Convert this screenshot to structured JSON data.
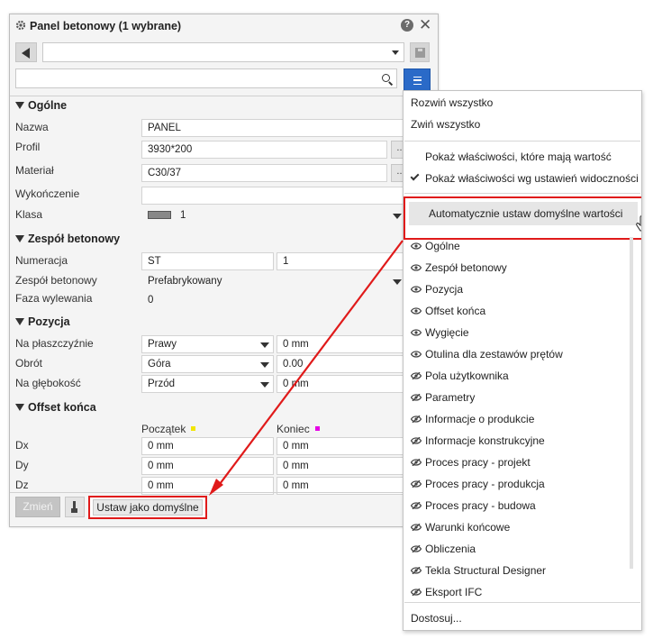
{
  "panel": {
    "title": "Panel betonowy (1 wybrane)",
    "help": "?",
    "preset_value": "",
    "search_placeholder": "",
    "sections": {
      "ogolne": "Ogólne",
      "zespol": "Zespół betonowy",
      "pozycja": "Pozycja",
      "offset": "Offset końca"
    },
    "ogolne": {
      "nazwa_label": "Nazwa",
      "nazwa_value": "PANEL",
      "profil_label": "Profil",
      "profil_value": "3930*200",
      "material_label": "Materiał",
      "material_value": "C30/37",
      "wykonczenie_label": "Wykończenie",
      "wykonczenie_value": "",
      "klasa_label": "Klasa",
      "klasa_value": "1"
    },
    "zespol": {
      "numeracja_label": "Numeracja",
      "numeracja_prefix": "ST",
      "numeracja_start": "1",
      "zespol_label": "Zespół betonowy",
      "zespol_value": "Prefabrykowany",
      "faza_label": "Faza wylewania",
      "faza_value": "0"
    },
    "pozycja": {
      "plaszczyzna_label": "Na płaszczyźnie",
      "plaszczyzna_value": "Prawy",
      "plaszczyzna_offset": "0 mm",
      "obrot_label": "Obrót",
      "obrot_value": "Góra",
      "obrot_offset": "0.00",
      "glebokosc_label": "Na głębokość",
      "glebokosc_value": "Przód",
      "glebokosc_offset": "0 mm"
    },
    "offset": {
      "start_header": "Początek",
      "end_header": "Koniec",
      "dx_label": "Dx",
      "dx_start": "0 mm",
      "dx_end": "0 mm",
      "dy_label": "Dy",
      "dy_start": "0 mm",
      "dy_end": "0 mm",
      "dz_label": "Dz",
      "dz_start": "0 mm",
      "dz_end": "0 mm"
    },
    "buttons": {
      "modify": "Zmień",
      "set_default": "Ustaw jako domyślne"
    }
  },
  "menu": {
    "expand_all": "Rozwiń wszystko",
    "collapse_all": "Zwiń wszystko",
    "show_with_value": "Pokaż właściwości, które mają wartość",
    "show_by_visibility": "Pokaż właściwości wg ustawień widoczności",
    "auto_defaults": "Automatycznie ustaw domyślne wartości",
    "customize": "Dostosuj...",
    "visible_groups": [
      "Ogólne",
      "Zespół betonowy",
      "Pozycja",
      "Offset końca",
      "Wygięcie",
      "Otulina dla zestawów prętów"
    ],
    "hidden_groups": [
      "Pola użytkownika",
      "Parametry",
      "Informacje o produkcie",
      "Informacje konstrukcyjne",
      "Proces pracy - projekt",
      "Proces pracy - produkcja",
      "Proces pracy - budowa",
      "Warunki końcowe",
      "Obliczenia",
      "Tekla Structural Designer",
      "Eksport IFC"
    ]
  },
  "colors": {
    "accent": "#2a6ac8",
    "highlight_border": "#e01a1a",
    "start_marker": "#f2e600",
    "end_marker": "#e600e6"
  }
}
